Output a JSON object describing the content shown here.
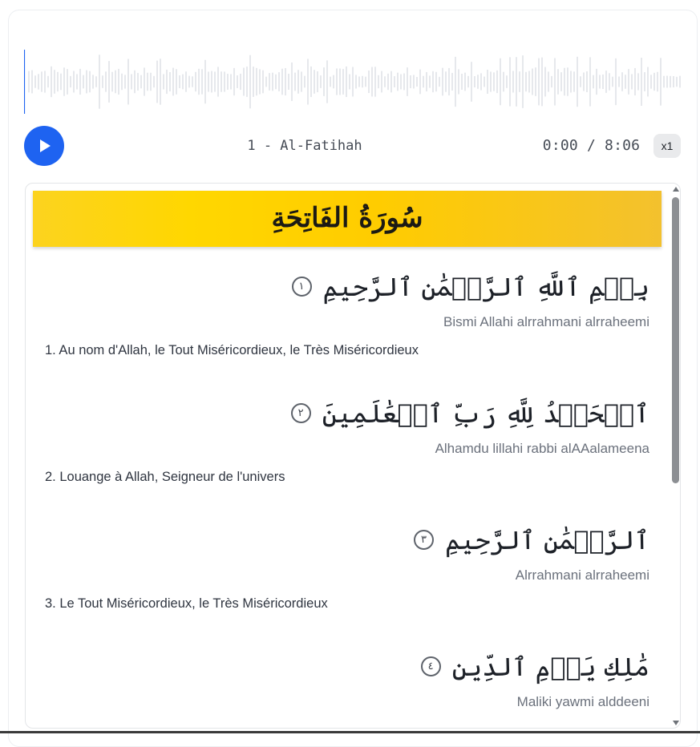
{
  "player": {
    "track_title": "1 - Al-Fatihah",
    "time_display": "0:00 / 8:06",
    "speed_label": "x1",
    "progress": 0,
    "accent_color": "#1e63f1",
    "play_icon": "play-icon"
  },
  "surah": {
    "banner_title": "سُورَةُ الفَاتِحَةِ"
  },
  "verses": [
    {
      "arabic": "بِسۡمِ ٱللَّهِ ٱلرَّحۡمَٰنِ ٱلرَّحِيمِ",
      "number": "١",
      "transliteration": "Bismi Allahi alrrahmani alrraheemi",
      "translation": "1. Au nom d'Allah, le Tout Miséricordieux, le Très Miséricordieux"
    },
    {
      "arabic": "ٱلۡحَمۡدُ لِلَّهِ رَبِّ ٱلۡعَٰلَمِينَ",
      "number": "٢",
      "transliteration": "Alhamdu lillahi rabbi alAAalameena",
      "translation": "2. Louange à Allah, Seigneur de l'univers"
    },
    {
      "arabic": "ٱلرَّحۡمَٰنِ ٱلرَّحِيمِ",
      "number": "٣",
      "transliteration": "Alrrahmani alrraheemi",
      "translation": "3. Le Tout Miséricordieux, le Très Miséricordieux"
    },
    {
      "arabic": "مَٰلِكِ يَوۡمِ ٱلدِّينِ",
      "number": "٤",
      "transliteration": "Maliki yawmi alddeeni",
      "translation": ""
    }
  ]
}
